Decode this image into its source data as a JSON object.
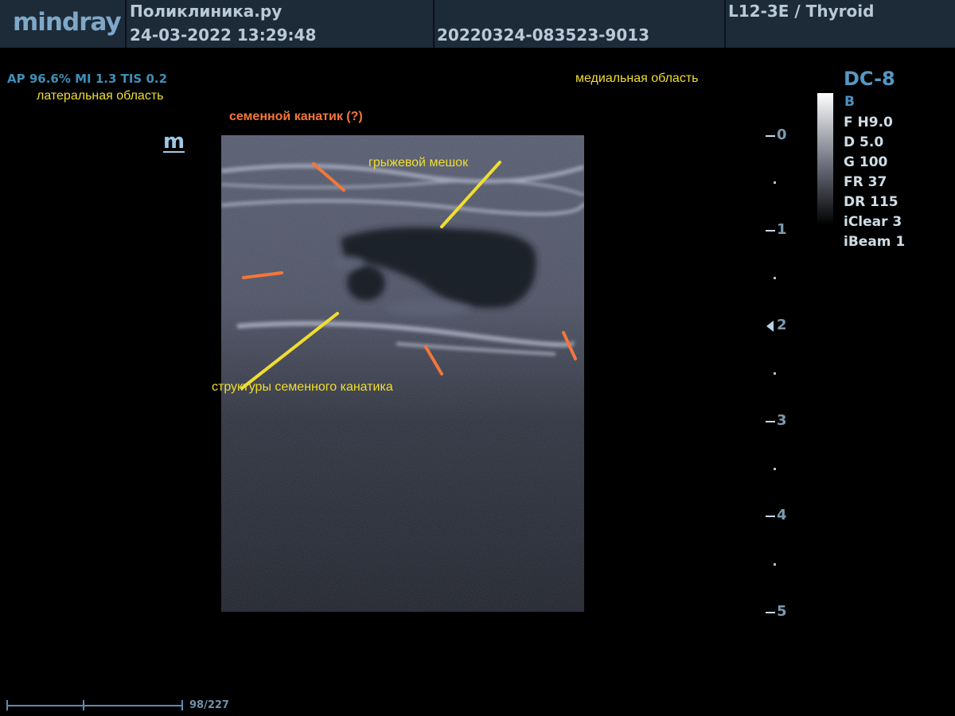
{
  "header": {
    "brand": "mindray",
    "clinic": "Поликлиника.ру",
    "datetime": "24-03-2022  13:29:48",
    "exam_id": "20220324-083523-9013",
    "probe_preset": "L12-3E / Thyroid"
  },
  "acoustic": {
    "text": "AP 96.6%  MI 1.3 TIS 0.2"
  },
  "annotations": {
    "lateral": "латеральная область",
    "medial": "медиальная область",
    "cord_question": "семенной канатик (?)",
    "hernia_sac": "грыжевой мешок",
    "cord_structures": "структуры  семенного канатика"
  },
  "marker": "m",
  "depth_scale": {
    "labels": [
      "0",
      "1",
      "2",
      "3",
      "4",
      "5"
    ]
  },
  "params": {
    "dc": "DC-8",
    "mode": "B",
    "lines": [
      "F H9.0",
      "D 5.0",
      "G 100",
      "FR 37",
      "DR 115",
      "iClear 3",
      "iBeam 1"
    ]
  },
  "cine": {
    "frame": "98/227"
  },
  "colors": {
    "annotation_yellow": "#f0dd30",
    "annotation_orange": "#f4763a",
    "header_bg": "#1d2a38"
  }
}
